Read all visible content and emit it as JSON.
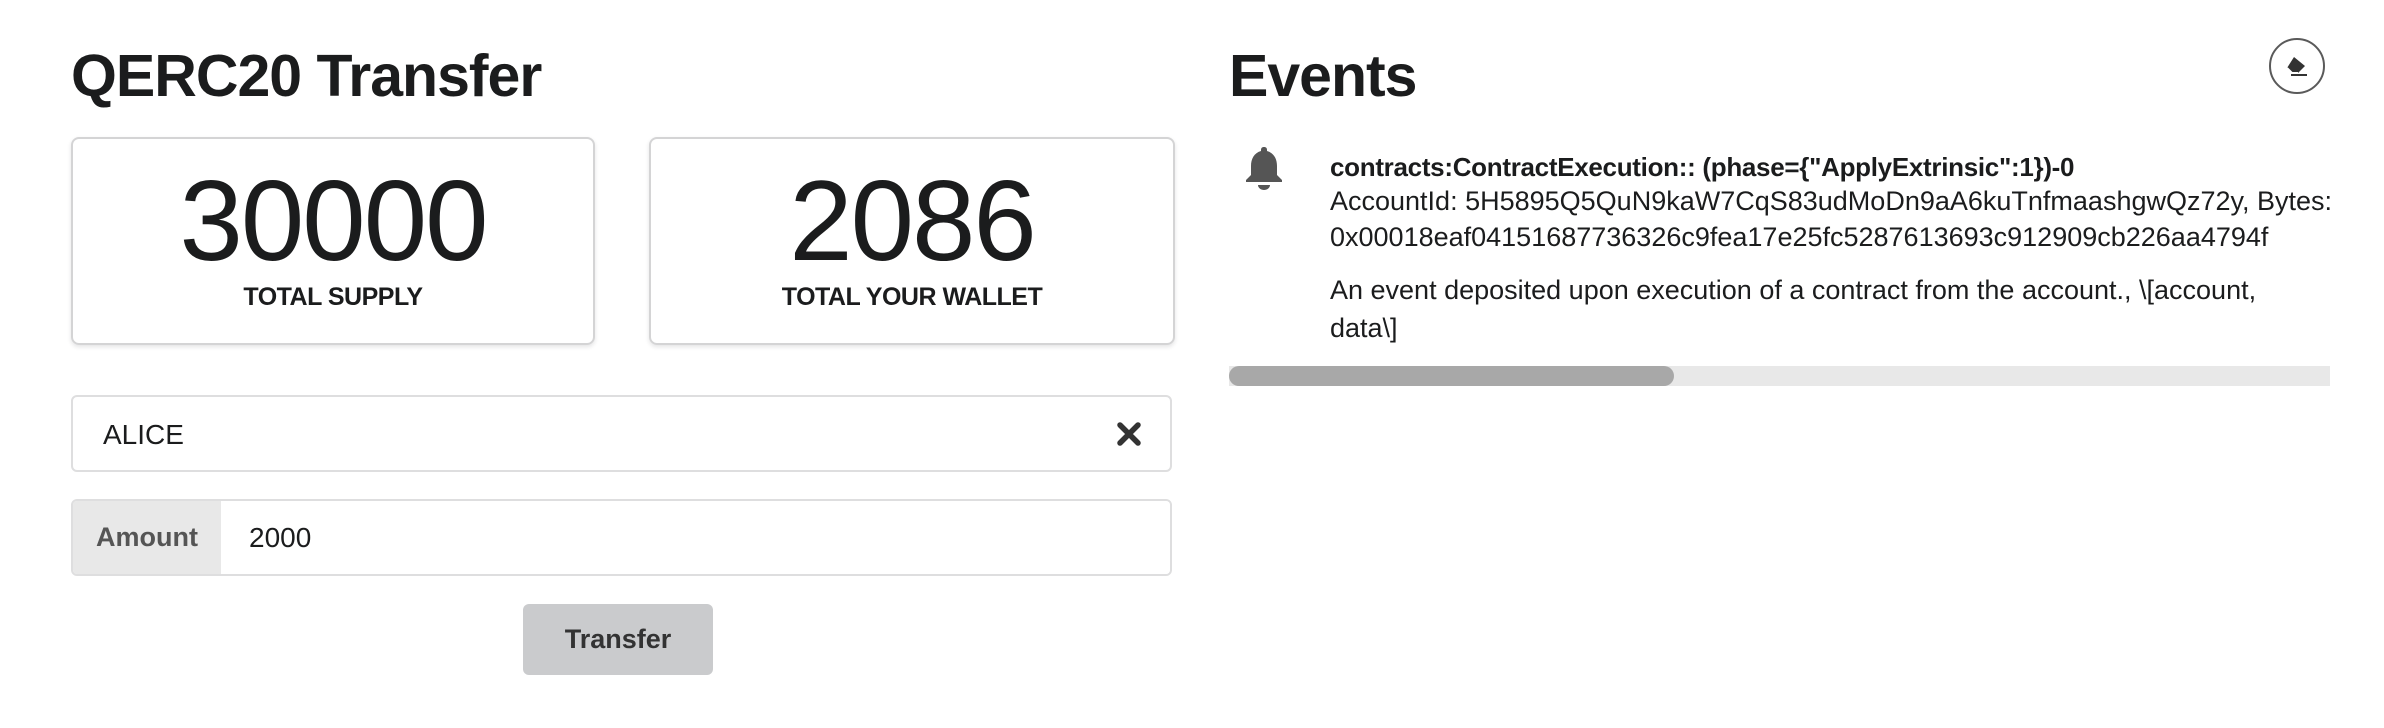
{
  "left": {
    "title": "QERC20 Transfer",
    "total_supply": {
      "value": "30000",
      "label": "TOTAL SUPPLY"
    },
    "total_wallet": {
      "value": "2086",
      "label": "TOTAL YOUR WALLET"
    },
    "recipient": {
      "value": "ALICE",
      "clear_icon": "close-icon"
    },
    "amount": {
      "label": "Amount",
      "value": "2000"
    },
    "transfer_label": "Transfer"
  },
  "events": {
    "title": "Events",
    "clear_icon": "eraser-icon",
    "items": [
      {
        "icon": "bell-icon",
        "header": "contracts:ContractExecution:: (phase={\"ApplyExtrinsic\":1})-0",
        "account_line": "AccountId: 5H5895Q5QuN9kaW7CqS83udMoDn9aA6kuTnfmaashgwQz72y, Bytes:",
        "bytes_line": "0x00018eaf04151687736326c9fea17e25fc5287613693c912909cb226aa4794f",
        "description": "An event deposited upon execution of a contract from the account., \\[account, data\\]"
      }
    ],
    "scroll_position": 0.0
  }
}
